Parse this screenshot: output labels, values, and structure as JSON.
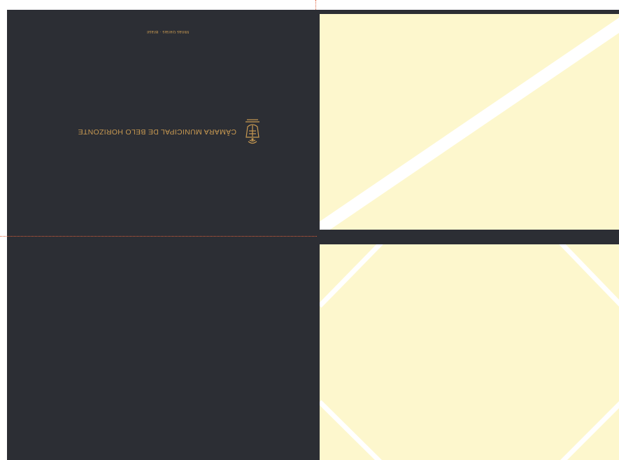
{
  "colors": {
    "dark": "#2c2e34",
    "cream": "#fdf7cd",
    "gold": "#c99a52",
    "guide": "#e0603a",
    "fold_line": "#ffffff"
  },
  "cover": {
    "title": "CÂMARA MUNICIPAL DE BELO HORIZONTE",
    "city_line": "Minas Gerais · Brasil",
    "crest_icon": "coat-of-arms-icon",
    "orientation": "upside-down"
  }
}
